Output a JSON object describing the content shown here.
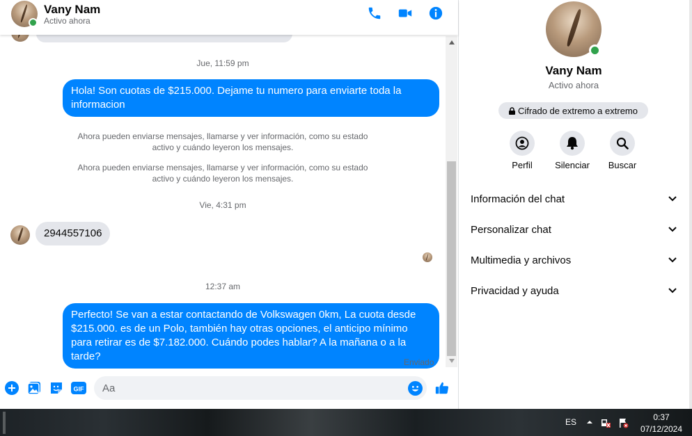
{
  "contact": {
    "name": "Vany Nam",
    "status": "Activo ahora"
  },
  "messages": {
    "timestamp_1": "Jue, 11:59 pm",
    "outgoing_1": "Hola! Son cuotas de $215.000. Dejame tu numero para enviarte toda la informacion",
    "system_1": "Ahora pueden enviarse mensajes, llamarse y ver información, como su estado activo y cuándo leyeron los mensajes.",
    "system_2": "Ahora pueden enviarse mensajes, llamarse y ver información, como su estado activo y cuándo leyeron los mensajes.",
    "timestamp_2": "Vie, 4:31 pm",
    "incoming_1": "2944557106",
    "timestamp_3": "12:37 am",
    "outgoing_2": "Perfecto!  Se van a estar contactando de Volkswagen 0km, La cuota desde $215.000. es de un Polo, también hay otras opciones, el anticipo mínimo para retirar es de $7.182.000. Cuándo podes hablar? A la mañana o a la tarde?",
    "sent_status": "Enviado"
  },
  "composer": {
    "placeholder": "Aa",
    "gif_label": "GIF"
  },
  "panel": {
    "name": "Vany Nam",
    "status": "Activo ahora",
    "encryption": "Cifrado de extremo a extremo",
    "actions": [
      {
        "label": "Perfil",
        "icon": "profile-icon"
      },
      {
        "label": "Silenciar",
        "icon": "bell-icon"
      },
      {
        "label": "Buscar",
        "icon": "search-icon"
      }
    ],
    "sections": [
      {
        "label": "Información del chat"
      },
      {
        "label": "Personalizar chat"
      },
      {
        "label": "Multimedia y archivos"
      },
      {
        "label": "Privacidad y ayuda"
      }
    ]
  },
  "taskbar": {
    "language": "ES",
    "time": "0:37",
    "date": "07/12/2024"
  },
  "colors": {
    "accent": "#0084ff",
    "online": "#31a24c",
    "bubble_incoming": "#e4e6eb",
    "secondary_text": "#65676b"
  }
}
